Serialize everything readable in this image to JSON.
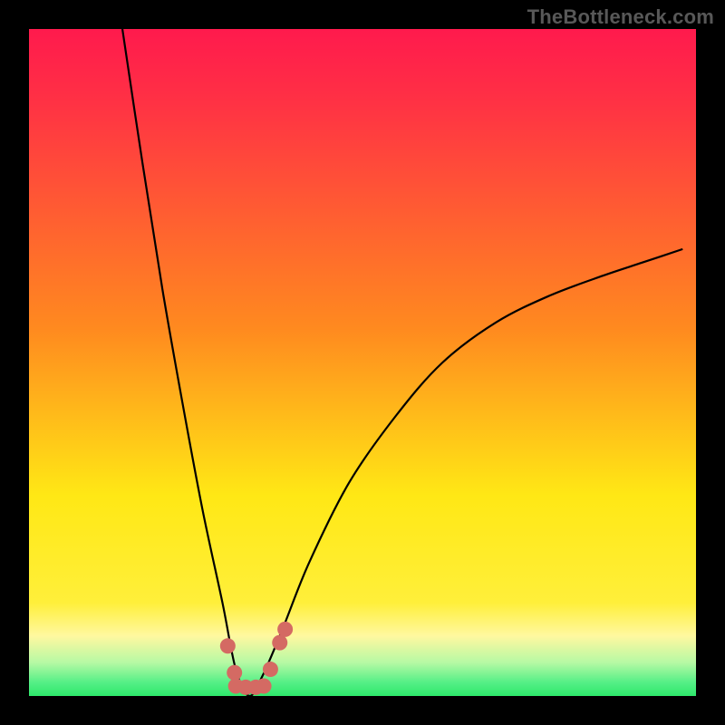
{
  "watermark": "TheBottleneck.com",
  "palette": {
    "red": "#ff1a4d",
    "orange": "#ff8a1f",
    "yellow": "#ffe815",
    "pale_yellow": "#fff8a0",
    "green_pale": "#b6f9a4",
    "green": "#2ee86b",
    "curve_stroke": "#000000",
    "marker_fill": "#d46a63",
    "marker_stroke": "#a8534c",
    "black": "#000000"
  },
  "chart_data": {
    "type": "line",
    "title": "",
    "xlabel": "",
    "ylabel": "",
    "xlim": [
      0,
      100
    ],
    "ylim": [
      0,
      100
    ],
    "x_trough": 33,
    "trough_y": 0,
    "curve_left_start": {
      "x": 14,
      "y": 100
    },
    "curve_right_end": {
      "x": 98,
      "y": 67
    },
    "series": [
      {
        "name": "bottleneck-curve",
        "x": [
          14,
          17,
          20,
          23,
          26,
          29,
          31,
          33,
          35,
          38,
          42,
          48,
          55,
          62,
          70,
          78,
          86,
          92,
          98
        ],
        "y": [
          100,
          80,
          61,
          44,
          28,
          14,
          4,
          0,
          3,
          10,
          20,
          32,
          42,
          50,
          56,
          60,
          63,
          65,
          67
        ]
      }
    ],
    "markers": [
      {
        "x": 29.8,
        "y": 7.5
      },
      {
        "x": 30.8,
        "y": 3.5
      },
      {
        "x": 31.0,
        "y": 1.5
      },
      {
        "x": 32.5,
        "y": 1.3
      },
      {
        "x": 34.0,
        "y": 1.3
      },
      {
        "x": 35.2,
        "y": 1.5
      },
      {
        "x": 36.2,
        "y": 4.0
      },
      {
        "x": 37.6,
        "y": 8.0
      },
      {
        "x": 38.4,
        "y": 10.0
      }
    ],
    "green_band_y_range": [
      0,
      3
    ],
    "pale_band_y_range": [
      3,
      9
    ]
  }
}
